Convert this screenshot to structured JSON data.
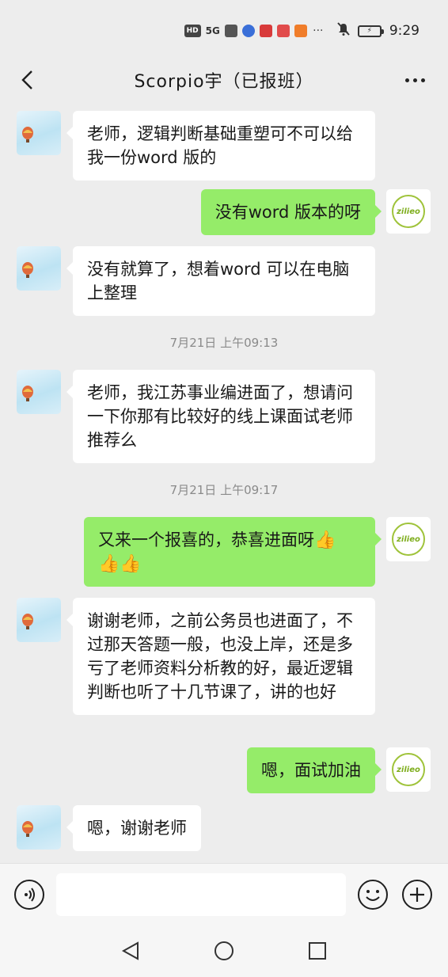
{
  "status_bar": {
    "hd_label": "HD",
    "signal_label": "5G",
    "time": "9:29",
    "battery_label": "⚡"
  },
  "header": {
    "title": "Scorpio宇（已报班）"
  },
  "messages": [
    {
      "type": "left",
      "text": "老师，逻辑判断基础重塑可不可以给我一份word 版的"
    },
    {
      "type": "right",
      "text": "没有word 版本的呀"
    },
    {
      "type": "left",
      "text": "没有就算了，想着word 可以在电脑上整理"
    },
    {
      "type": "time",
      "text": "7月21日 上午09:13"
    },
    {
      "type": "left",
      "text": "老师，我江苏事业编进面了，想请问一下你那有比较好的线上课面试老师推荐么"
    },
    {
      "type": "time",
      "text": "7月21日 上午09:17"
    },
    {
      "type": "right",
      "text": "又来一个报喜的，恭喜进面呀",
      "emoji": [
        "👍",
        "👍",
        "👍"
      ]
    },
    {
      "type": "left",
      "text": "谢谢老师，之前公务员也进面了，不过那天答题一般，也没上岸，还是多亏了老师资料分析教的好，最近逻辑判断也听了十几节课了，讲的也好"
    },
    {
      "type": "right",
      "text": "嗯，面试加油"
    },
    {
      "type": "left",
      "text": "嗯，谢谢老师"
    }
  ],
  "my_avatar_text": "zilieo",
  "input": {
    "value": "",
    "placeholder": ""
  },
  "colors": {
    "background": "#ededed",
    "bubble_self": "#95ec69",
    "bubble_other": "#ffffff",
    "timestamp_text": "#8a8a8a"
  }
}
